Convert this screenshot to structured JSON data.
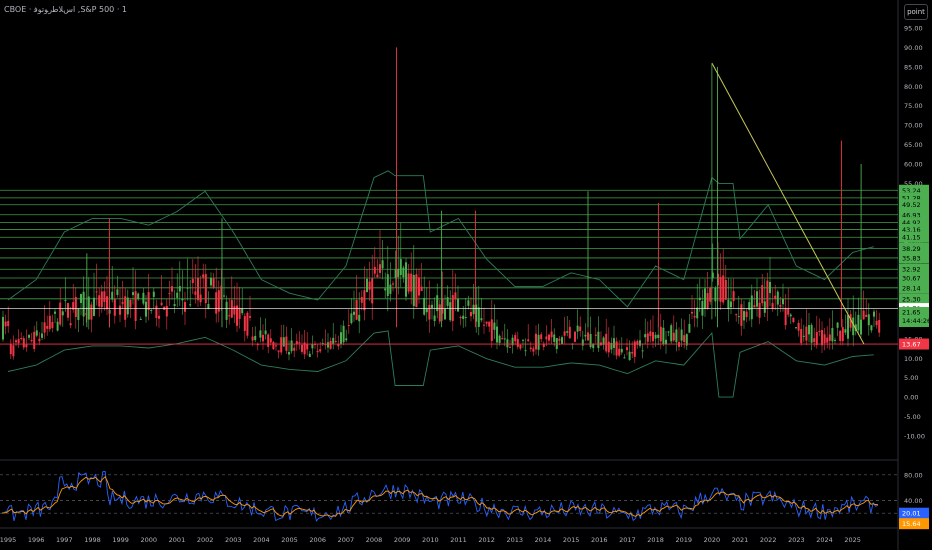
{
  "header": {
    "title": "CBOE · ﺍﺱﻼﻃﺭﻮﺗﻮﻓ ,S&P 500 · 1",
    "unit_button": "point"
  },
  "colors": {
    "background": "#000000",
    "candle_up": "#4caf50",
    "candle_down": "#f23645",
    "band": "#2e7d5a",
    "level_lines": "#4caf50",
    "trendline": "#c8c85a",
    "support_line": "#f23645",
    "osc_blue": "#2962ff",
    "osc_orange": "#ff9800",
    "label_green": "#4caf50",
    "label_red": "#f23645",
    "label_white": "#ffffff"
  },
  "price_axis": {
    "ticks": [
      "95.00",
      "90.00",
      "85.00",
      "80.00",
      "75.00",
      "70.00",
      "65.00",
      "60.00",
      "55.00",
      "50.00",
      "45.00",
      "40.00",
      "35.00",
      "30.00",
      "25.00",
      "20.00",
      "15.00",
      "10.00",
      "5.00",
      "0.00",
      "-5.00",
      "-10.00"
    ]
  },
  "level_labels": [
    "53.24",
    "51.28",
    "49.52",
    "46.93",
    "44.92",
    "43.16",
    "41.15",
    "38.29",
    "35.83",
    "32.92",
    "30.67",
    "28.14",
    "25.30"
  ],
  "current_labels": {
    "white": "22.79",
    "price": "21.65",
    "countdown": "14:44:26",
    "support": "13.67"
  },
  "osc_axis": {
    "ticks": [
      "80.00",
      "40.00"
    ]
  },
  "osc_labels": {
    "blue": "20.01",
    "orange": "15.64"
  },
  "time_axis": {
    "labels": [
      "1995",
      "1996",
      "1997",
      "1998",
      "1999",
      "2000",
      "2001",
      "2002",
      "2003",
      "2004",
      "2005",
      "2006",
      "2007",
      "2008",
      "2009",
      "2010",
      "2011",
      "2012",
      "2013",
      "2014",
      "2015",
      "2016",
      "2017",
      "2018",
      "2019",
      "2020",
      "2021",
      "2022",
      "2023",
      "2024",
      "2025"
    ]
  },
  "chart_data": {
    "type": "candlestick",
    "symbol": "CBOE · ﺍﺱﻼﻃﺭﻮﺗﻮﻓ ,S&P 500",
    "interval": "1",
    "price_range": [
      -10,
      95
    ],
    "horizontal_levels": [
      53.24,
      51.28,
      49.52,
      46.93,
      44.92,
      43.16,
      41.15,
      38.29,
      35.83,
      32.92,
      30.67,
      28.14,
      25.3
    ],
    "support_level": 13.67,
    "last_price": 21.65,
    "marked_value": 22.79,
    "trendline": {
      "from": [
        "2020",
        86
      ],
      "to": [
        "2025.4",
        13.67
      ]
    },
    "spikes": [
      {
        "x": "1997.8",
        "high": 37
      },
      {
        "x": "1998.6",
        "high": 46
      },
      {
        "x": "2002.6",
        "high": 46
      },
      {
        "x": "2008.8",
        "high": 90
      },
      {
        "x": "2010.4",
        "high": 48
      },
      {
        "x": "2011.6",
        "high": 48
      },
      {
        "x": "2015.6",
        "high": 53
      },
      {
        "x": "2018.1",
        "high": 50
      },
      {
        "x": "2020.2",
        "high": 85
      },
      {
        "x": "2024.6",
        "high": 66
      },
      {
        "x": "2025.3",
        "high": 60
      }
    ],
    "oscillator": {
      "series": [
        {
          "name": "",
          "last": 20.01
        },
        {
          "name": "",
          "last": 15.64
        }
      ],
      "levels": [
        80,
        40
      ]
    }
  }
}
